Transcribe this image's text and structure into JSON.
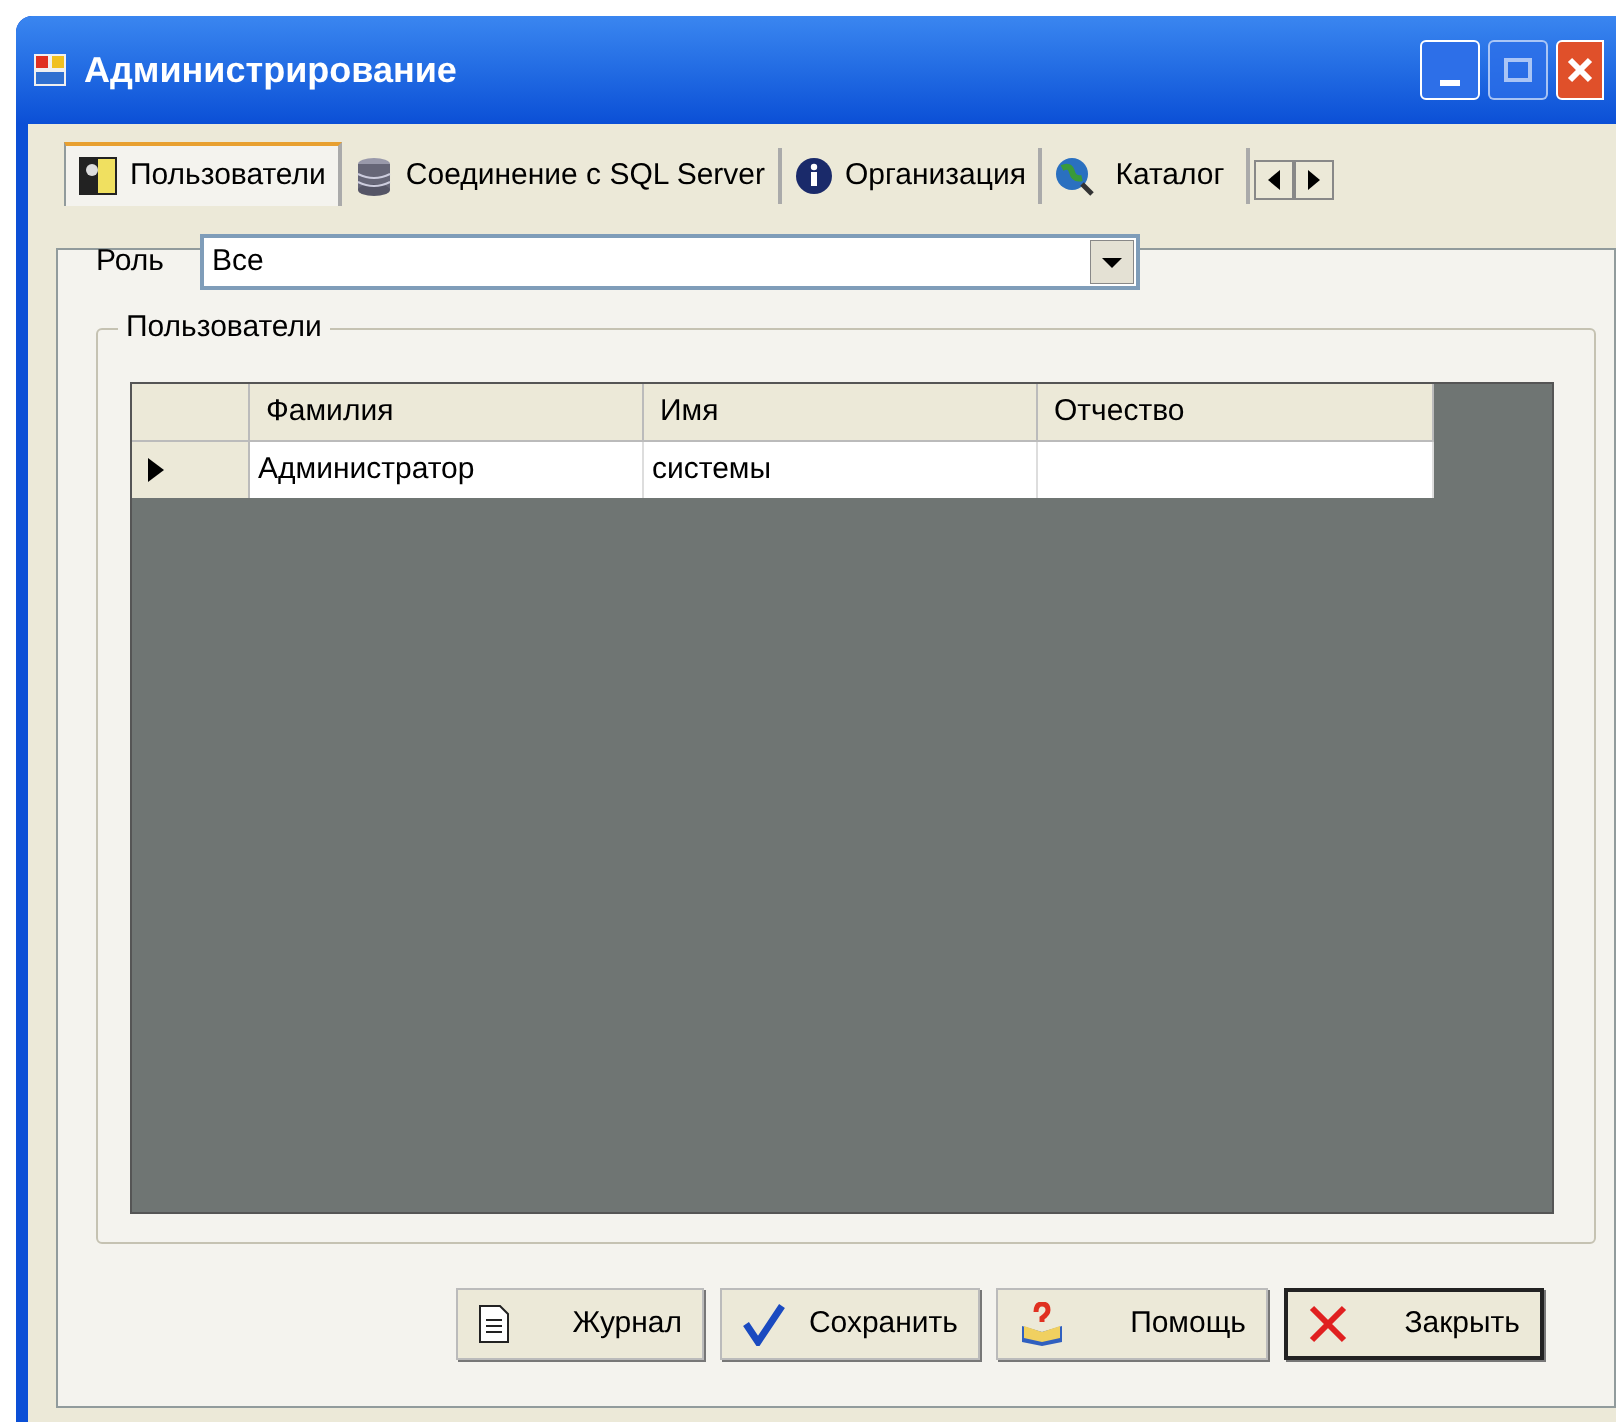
{
  "window": {
    "title": "Администрирование"
  },
  "tabs": [
    {
      "label": "Пользователи",
      "kind": "users",
      "selected": true
    },
    {
      "label": "Соединение с SQL Server",
      "kind": "database",
      "selected": false
    },
    {
      "label": "Организация",
      "kind": "info",
      "selected": false
    },
    {
      "label": "Каталог",
      "kind": "globe",
      "selected": false
    }
  ],
  "role": {
    "label": "Роль",
    "value": "Все"
  },
  "group": {
    "title": "Пользователи"
  },
  "table": {
    "columns": [
      "Фамилия",
      "Имя",
      "Отчество"
    ],
    "rows": [
      {
        "cells": [
          "Администратор",
          "системы",
          ""
        ],
        "selected": true
      }
    ]
  },
  "buttons": [
    {
      "label": "Журнал",
      "kind": "journal",
      "default": false
    },
    {
      "label": "Сохранить",
      "kind": "save",
      "default": false
    },
    {
      "label": "Помощь",
      "kind": "help",
      "default": false
    },
    {
      "label": "Закрыть",
      "kind": "close",
      "default": true
    }
  ]
}
